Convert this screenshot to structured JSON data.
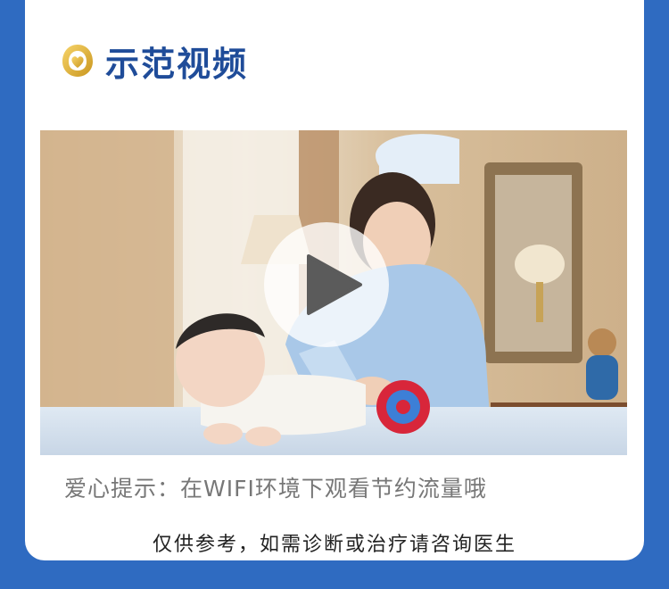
{
  "header": {
    "title": "示范视频",
    "logo_icon": "golden-heart-logo-icon"
  },
  "video": {
    "thumbnail": "nurse-with-baby-photo",
    "play_icon": "play-icon"
  },
  "tip": {
    "text": "爱心提示：在WIFI环境下观看节约流量哦"
  },
  "disclaimer": {
    "text": "仅供参考，如需诊断或治疗请咨询医生"
  },
  "colors": {
    "background": "#2f6bc1",
    "title": "#1f4c99",
    "tip": "#777777",
    "disclaimer": "#222222"
  }
}
